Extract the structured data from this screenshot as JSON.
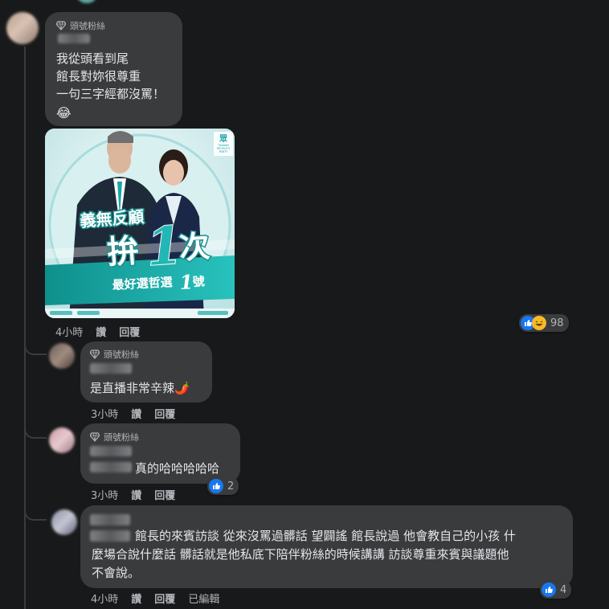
{
  "colors": {
    "background": "#18191a",
    "bubble": "#3a3b3c",
    "text": "#e4e6eb",
    "secondary_text": "#b0b3b8",
    "like_blue": "#1877f2",
    "teal": "#18b3b0"
  },
  "badge_label": "頭號粉絲",
  "comments": [
    {
      "lines": [
        "我從頭看到尾",
        "館長對妳很尊重",
        "一句三字經都沒罵！",
        "😂"
      ],
      "meta": {
        "time": "4小時",
        "like": "讚",
        "reply": "回覆"
      },
      "reactions": {
        "icons": [
          "like-icon",
          "haha-icon"
        ],
        "count": "98"
      },
      "image": {
        "headline": "義無反顧",
        "big_text_a": "拚",
        "big_number": "1",
        "big_text_b": "次",
        "slogan_a": "最好選哲選",
        "slogan_number": "1",
        "slogan_b": "號",
        "party_lines": [
          "眾",
          "TAIWAN",
          "PEOPLE'S",
          "PARTY"
        ]
      }
    },
    {
      "text": "是直播非常辛辣🌶️",
      "meta": {
        "time": "3小時",
        "like": "讚",
        "reply": "回覆"
      }
    },
    {
      "text": "真的哈哈哈哈哈",
      "meta": {
        "time": "3小時",
        "like": "讚",
        "reply": "回覆"
      },
      "reactions": {
        "icons": [
          "like-icon"
        ],
        "count": "2"
      }
    },
    {
      "lines": [
        "館長的來賓訪談 從來沒罵過髒話 望闢謠 館長說過 他會教自己的小孩 什",
        "麼場合說什麼話 髒話就是他私底下陪伴粉絲的時候講講 訪談尊重來賓與議題他",
        "不會說。"
      ],
      "meta": {
        "time": "4小時",
        "like": "讚",
        "reply": "回覆",
        "edited": "已編輯"
      },
      "reactions": {
        "icons": [
          "like-icon"
        ],
        "count": "4"
      }
    }
  ]
}
